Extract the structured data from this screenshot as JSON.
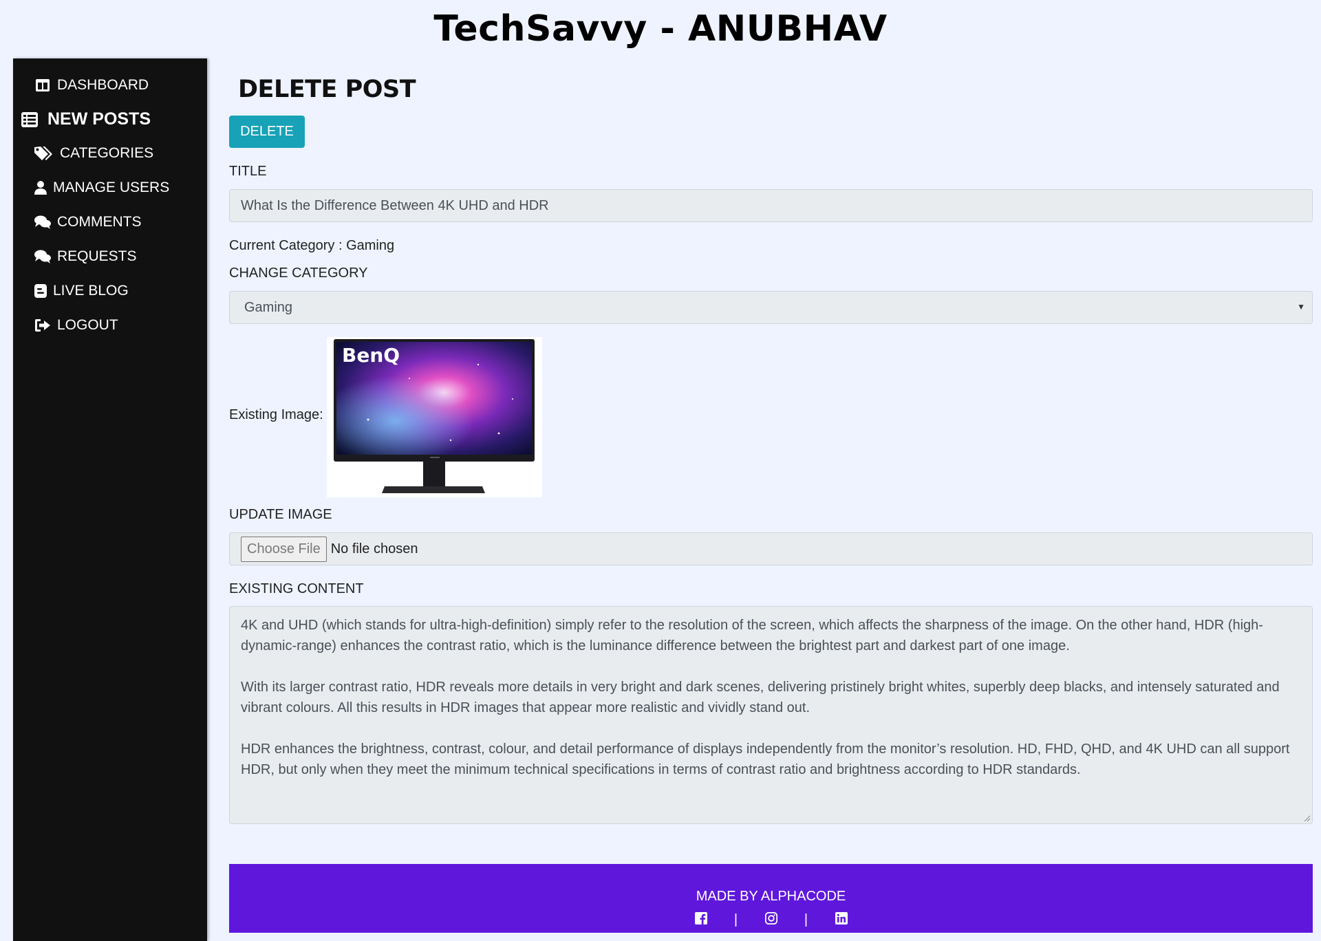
{
  "site": {
    "title": "TechSavvy - ANUBHAV"
  },
  "sidebar": {
    "items": [
      {
        "label": "DASHBOARD",
        "icon": "dashboard-icon"
      },
      {
        "label": "NEW POSTS",
        "icon": "list-icon",
        "active": true
      },
      {
        "label": "CATEGORIES",
        "icon": "tags-icon"
      },
      {
        "label": "MANAGE USERS",
        "icon": "user-icon"
      },
      {
        "label": "COMMENTS",
        "icon": "comments-icon"
      },
      {
        "label": "REQUESTS",
        "icon": "comments-icon"
      },
      {
        "label": "LIVE BLOG",
        "icon": "blogger-icon"
      },
      {
        "label": "LOGOUT",
        "icon": "sign-out-icon"
      }
    ]
  },
  "form": {
    "heading": "DELETE POST",
    "delete_label": "DELETE",
    "title_label": "TITLE",
    "title_value": "What Is the Difference Between 4K UHD and HDR",
    "current_category_text": "Current Category : Gaming",
    "change_category_label": "CHANGE CATEGORY",
    "category_selected": "Gaming",
    "existing_image_label": "Existing Image:",
    "update_image_label": "UPDATE IMAGE",
    "choose_file_label": "Choose File",
    "no_file_text": "No file chosen",
    "existing_content_label": "EXISTING CONTENT",
    "content_paragraphs": [
      "4K and UHD (which stands for ultra-high-definition) simply refer to the resolution of the screen, which affects the sharpness of the image. On the other hand, HDR (high-dynamic-range) enhances the contrast ratio, which is the luminance difference between the brightest part and darkest part of one image.",
      "With its larger contrast ratio, HDR reveals more details in very bright and dark scenes, delivering pristinely bright whites, superbly deep blacks, and intensely saturated and vibrant colours. All this results in HDR images that appear more realistic and vividly stand out.",
      "HDR enhances the brightness, contrast, colour, and detail performance of displays independently from the monitor’s resolution. HD, FHD, QHD, and 4K UHD can all support HDR, but only when they meet the minimum technical specifications in terms of contrast ratio and brightness according to HDR standards."
    ],
    "image_brand_text": "BenQ"
  },
  "footer": {
    "made_by": "MADE BY ALPHACODE",
    "separator": "|",
    "socials": [
      "facebook-icon",
      "instagram-icon",
      "linkedin-icon"
    ]
  },
  "colors": {
    "page_bg": "#eef3ff",
    "sidebar_bg": "#111111",
    "delete_button": "#17a2b8",
    "footer_bg": "#5f17dc"
  }
}
